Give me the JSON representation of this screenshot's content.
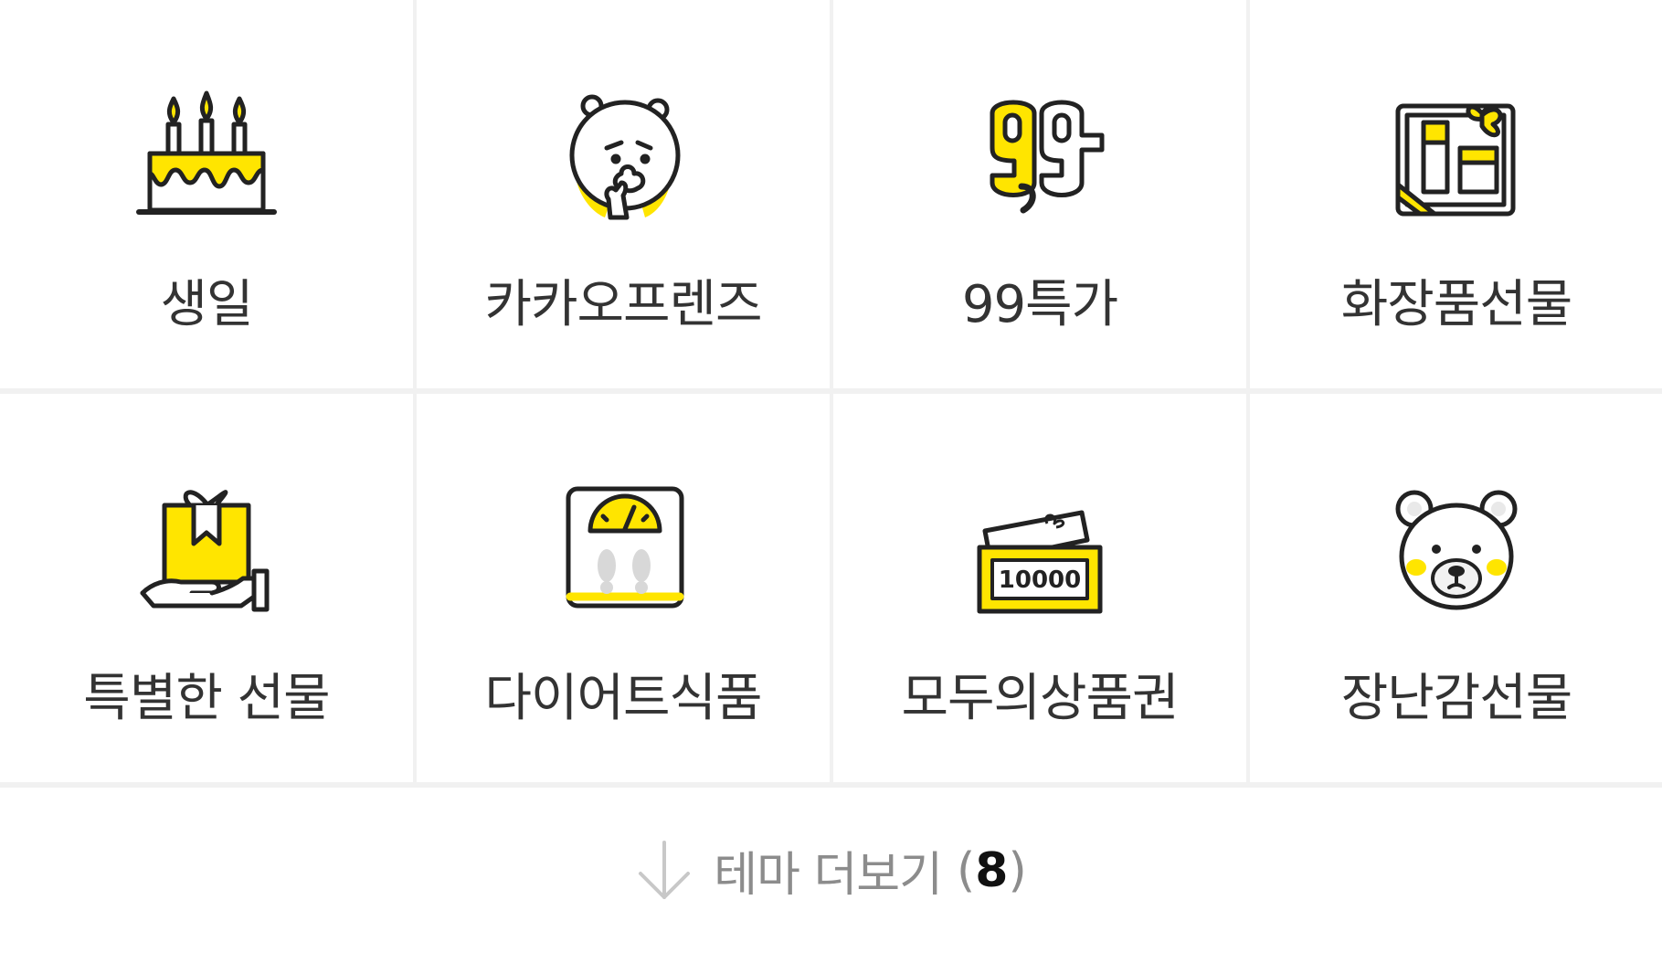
{
  "themes": [
    {
      "label": "생일",
      "icon": "birthday-cake-icon"
    },
    {
      "label": "카카오프렌즈",
      "icon": "kakao-ryan-icon"
    },
    {
      "label": "99특가",
      "icon": "special-99-icon"
    },
    {
      "label": "화장품선물",
      "icon": "cosmetics-box-icon"
    },
    {
      "label": "특별한 선물",
      "icon": "gift-hand-icon"
    },
    {
      "label": "다이어트식품",
      "icon": "scale-icon"
    },
    {
      "label": "모두의상품권",
      "icon": "voucher-icon"
    },
    {
      "label": "장난감선물",
      "icon": "teddy-bear-icon"
    }
  ],
  "voucher_value": "10000",
  "more": {
    "label": "테마 더보기",
    "open_paren": "(",
    "count": "8",
    "close_paren": ")"
  },
  "colors": {
    "accent": "#FFE500",
    "stroke": "#222222",
    "label": "#333333",
    "muted": "#8C8C8C"
  }
}
